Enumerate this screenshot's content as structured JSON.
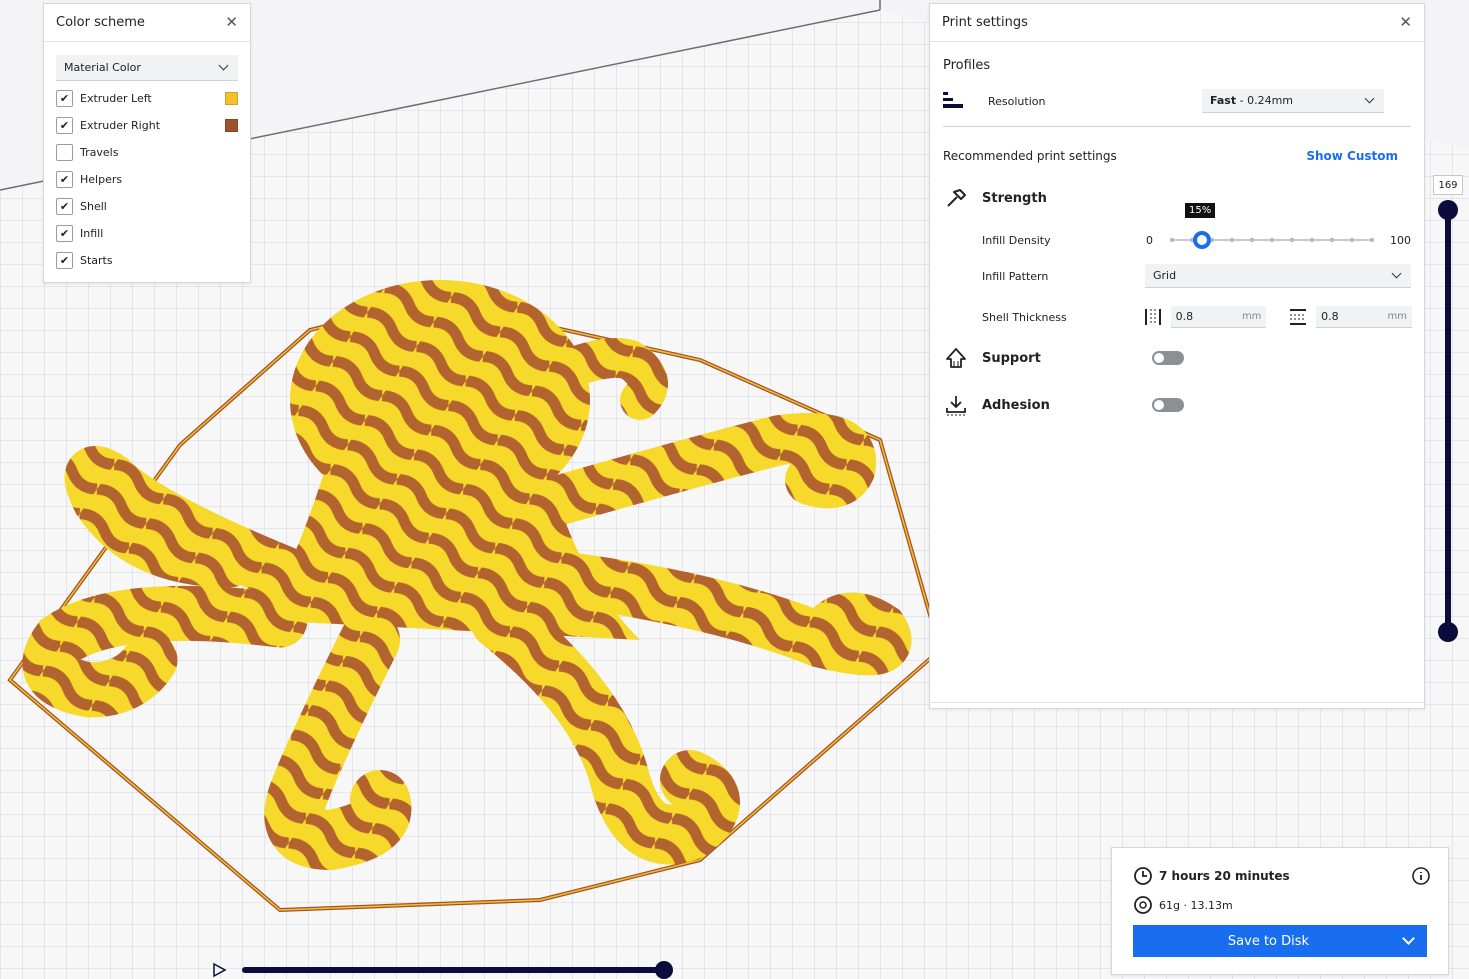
{
  "color_scheme": {
    "title": "Color scheme",
    "scheme_value": "Material Color",
    "items": [
      {
        "label": "Extruder Left",
        "checked": true,
        "swatch": "#f6c02b"
      },
      {
        "label": "Extruder Right",
        "checked": true,
        "swatch": "#a0522d"
      },
      {
        "label": "Travels",
        "checked": false
      },
      {
        "label": "Helpers",
        "checked": true
      },
      {
        "label": "Shell",
        "checked": true
      },
      {
        "label": "Infill",
        "checked": true
      },
      {
        "label": "Starts",
        "checked": true
      }
    ]
  },
  "print_settings": {
    "title": "Print settings",
    "profiles_label": "Profiles",
    "resolution_label": "Resolution",
    "resolution_value_bold": "Fast",
    "resolution_value_rest": " - 0.24mm",
    "recommended_label": "Recommended print settings",
    "show_custom": "Show Custom",
    "strength_label": "Strength",
    "infill_density_label": "Infill Density",
    "infill_density_min": "0",
    "infill_density_max": "100",
    "infill_density_value": 15,
    "infill_density_tooltip": "15%",
    "infill_pattern_label": "Infill Pattern",
    "infill_pattern_value": "Grid",
    "shell_thickness_label": "Shell Thickness",
    "shell_wall_value": "0.8",
    "shell_topbottom_value": "0.8",
    "unit_mm": "mm",
    "support_label": "Support",
    "support_enabled": false,
    "adhesion_label": "Adhesion",
    "adhesion_enabled": false
  },
  "layer_slider": {
    "value": "169"
  },
  "summary": {
    "time": "7 hours 20 minutes",
    "material": "61g · 13.13m",
    "save_label": "Save to Disk"
  },
  "colors": {
    "accent": "#196ef0",
    "slider_dark": "#0c0c3a",
    "extruder_left": "#f6c02b",
    "extruder_right": "#a0522d"
  }
}
